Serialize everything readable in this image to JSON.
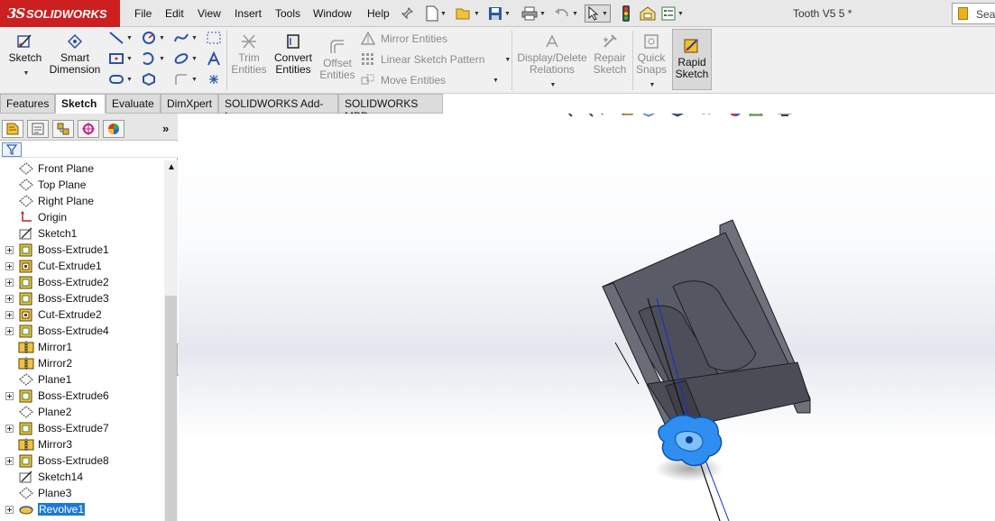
{
  "app": {
    "brand": "SOLIDWORKS",
    "ds_mark": "3S",
    "document_title": "Tooth V5 5 *"
  },
  "menu": [
    "File",
    "Edit",
    "View",
    "Insert",
    "Tools",
    "Window",
    "Help"
  ],
  "search": {
    "placeholder": "Sear"
  },
  "ribbon": {
    "sketch": "Sketch",
    "smart_dimension_1": "Smart",
    "smart_dimension_2": "Dimension",
    "trim_1": "Trim",
    "trim_2": "Entities",
    "convert_1": "Convert",
    "convert_2": "Entities",
    "offset_1": "Offset",
    "offset_2": "Entities",
    "mirror_entities": "Mirror Entities",
    "linear_pattern": "Linear Sketch Pattern",
    "move_entities": "Move Entities",
    "display_delete_1": "Display/Delete",
    "display_delete_2": "Relations",
    "repair_1": "Repair",
    "repair_2": "Sketch",
    "quick_snaps_1": "Quick",
    "quick_snaps_2": "Snaps",
    "rapid_1": "Rapid",
    "rapid_2": "Sketch"
  },
  "tabs": [
    "Features",
    "Sketch",
    "Evaluate",
    "DimXpert",
    "SOLIDWORKS Add-Ins",
    "SOLIDWORKS MBD"
  ],
  "active_tab": "Sketch",
  "tree": [
    {
      "label": "Front Plane",
      "icon": "plane-icon",
      "expandable": false
    },
    {
      "label": "Top Plane",
      "icon": "plane-icon",
      "expandable": false
    },
    {
      "label": "Right Plane",
      "icon": "plane-icon",
      "expandable": false
    },
    {
      "label": "Origin",
      "icon": "origin-icon",
      "expandable": false
    },
    {
      "label": "Sketch1",
      "icon": "sketch-icon",
      "expandable": false
    },
    {
      "label": "Boss-Extrude1",
      "icon": "boss-extrude-icon",
      "expandable": true
    },
    {
      "label": "Cut-Extrude1",
      "icon": "cut-extrude-icon",
      "expandable": true
    },
    {
      "label": "Boss-Extrude2",
      "icon": "boss-extrude-icon",
      "expandable": true
    },
    {
      "label": "Boss-Extrude3",
      "icon": "boss-extrude-icon",
      "expandable": true
    },
    {
      "label": "Cut-Extrude2",
      "icon": "cut-extrude-icon",
      "expandable": true
    },
    {
      "label": "Boss-Extrude4",
      "icon": "boss-extrude-icon",
      "expandable": true
    },
    {
      "label": "Mirror1",
      "icon": "mirror-icon",
      "expandable": false
    },
    {
      "label": "Mirror2",
      "icon": "mirror-icon",
      "expandable": false
    },
    {
      "label": "Plane1",
      "icon": "plane-icon",
      "expandable": false
    },
    {
      "label": "Boss-Extrude6",
      "icon": "boss-extrude-icon",
      "expandable": true
    },
    {
      "label": "Plane2",
      "icon": "plane-icon",
      "expandable": false
    },
    {
      "label": "Boss-Extrude7",
      "icon": "boss-extrude-icon",
      "expandable": true
    },
    {
      "label": "Mirror3",
      "icon": "mirror-icon",
      "expandable": false
    },
    {
      "label": "Boss-Extrude8",
      "icon": "boss-extrude-icon",
      "expandable": true
    },
    {
      "label": "Sketch14",
      "icon": "sketch-icon",
      "expandable": false
    },
    {
      "label": "Plane3",
      "icon": "plane-icon",
      "expandable": false
    },
    {
      "label": "Revolve1",
      "icon": "revolve-icon",
      "expandable": true,
      "selected": true
    }
  ],
  "colors": {
    "brand_red": "#cc1f1f",
    "selection_blue": "#1c78d8",
    "model_gray": "#5a5d68",
    "highlight_blue": "#2f8ff0"
  }
}
